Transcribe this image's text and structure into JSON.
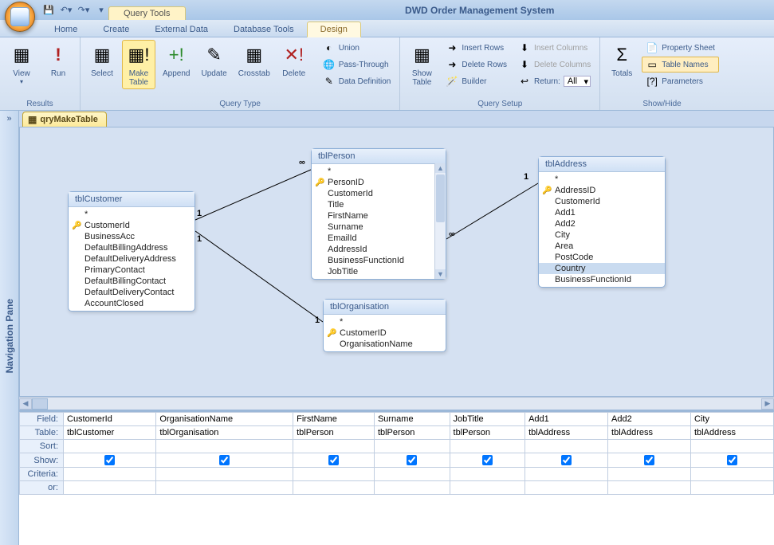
{
  "app": {
    "title": "DWD Order Management System",
    "context_tab": "Query Tools"
  },
  "tabs": [
    "Home",
    "Create",
    "External Data",
    "Database Tools",
    "Design"
  ],
  "active_tab": "Design",
  "ribbon": {
    "results": {
      "label": "Results",
      "view": "View",
      "run": "Run"
    },
    "query_type": {
      "label": "Query Type",
      "select": "Select",
      "make_table": "Make\nTable",
      "append": "Append",
      "update": "Update",
      "crosstab": "Crosstab",
      "delete": "Delete",
      "union": "Union",
      "pass_through": "Pass-Through",
      "data_def": "Data Definition"
    },
    "query_setup": {
      "label": "Query Setup",
      "show_table": "Show\nTable",
      "insert_rows": "Insert Rows",
      "delete_rows": "Delete Rows",
      "builder": "Builder",
      "insert_cols": "Insert Columns",
      "delete_cols": "Delete Columns",
      "return_lbl": "Return:",
      "return_val": "All"
    },
    "totals": {
      "label": "Show/Hide",
      "totals": "Totals",
      "property_sheet": "Property Sheet",
      "table_names": "Table Names",
      "parameters": "Parameters"
    }
  },
  "nav_pane": "Navigation Pane",
  "doc_tab": "qryMakeTable",
  "tables": {
    "customer": {
      "title": "tblCustomer",
      "fields": [
        "*",
        "CustomerId",
        "BusinessAcc",
        "DefaultBillingAddress",
        "DefaultDeliveryAddress",
        "PrimaryContact",
        "DefaultBillingContact",
        "DefaultDeliveryContact",
        "AccountClosed"
      ],
      "pk": 1
    },
    "person": {
      "title": "tblPerson",
      "fields": [
        "*",
        "PersonID",
        "CustomerId",
        "Title",
        "FirstName",
        "Surname",
        "EmailId",
        "AddressId",
        "BusinessFunctionId",
        "JobTitle"
      ],
      "pk": 1
    },
    "organisation": {
      "title": "tblOrganisation",
      "fields": [
        "*",
        "CustomerID",
        "OrganisationName"
      ],
      "pk": 1
    },
    "address": {
      "title": "tblAddress",
      "fields": [
        "*",
        "AddressID",
        "CustomerId",
        "Add1",
        "Add2",
        "City",
        "Area",
        "PostCode",
        "Country",
        "BusinessFunctionId"
      ],
      "pk": 1,
      "selected": 8
    }
  },
  "relations": [
    {
      "a": "customer",
      "b": "person",
      "a_card": "1",
      "b_card": "∞"
    },
    {
      "a": "customer",
      "b": "organisation",
      "a_card": "1",
      "b_card": "1"
    },
    {
      "a": "person",
      "b": "address",
      "a_card": "∞",
      "b_card": "1"
    }
  ],
  "qbe": {
    "rows": [
      "Field:",
      "Table:",
      "Sort:",
      "Show:",
      "Criteria:",
      "or:"
    ],
    "cols": [
      {
        "field": "CustomerId",
        "table": "tblCustomer",
        "show": true
      },
      {
        "field": "OrganisationName",
        "table": "tblOrganisation",
        "show": true
      },
      {
        "field": "FirstName",
        "table": "tblPerson",
        "show": true
      },
      {
        "field": "Surname",
        "table": "tblPerson",
        "show": true
      },
      {
        "field": "JobTitle",
        "table": "tblPerson",
        "show": true
      },
      {
        "field": "Add1",
        "table": "tblAddress",
        "show": true
      },
      {
        "field": "Add2",
        "table": "tblAddress",
        "show": true
      },
      {
        "field": "City",
        "table": "tblAddress",
        "show": true
      }
    ]
  }
}
